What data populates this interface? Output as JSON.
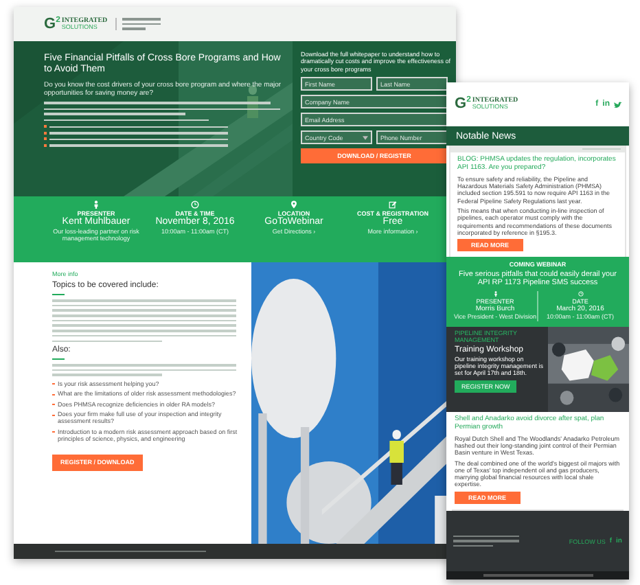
{
  "landing": {
    "logo": {
      "mark": "G$^{2}$",
      "name": "INTEGRATED",
      "sub": "SOLUTIONS"
    },
    "hero": {
      "title": "Five Financial Pitfalls of Cross Bore Programs and How to Avoid Them",
      "subtitle": "Do you know the cost drivers of your cross bore program and where the major opportunities for saving money are?"
    },
    "form": {
      "intro": "Download the full whitepaper to understand how to dramatically cut costs and improve the effectiveness of your cross bore programs",
      "fields": [
        {
          "placeholder": "First Name",
          "kind": "text"
        },
        {
          "placeholder": "Last Name",
          "kind": "text"
        },
        {
          "placeholder": "Company Name",
          "kind": "text"
        },
        {
          "placeholder": "Email Address",
          "kind": "text"
        },
        {
          "placeholder": "Country Code",
          "kind": "select"
        },
        {
          "placeholder": "Phone Number",
          "kind": "text"
        }
      ],
      "button": "DOWNLOAD / REGISTER"
    },
    "info": [
      {
        "kind": "person",
        "label": "PRESENTER",
        "value": "Kent Muhlbauer",
        "detail": "Our loss-leading partner on risk management technology"
      },
      {
        "kind": "clock",
        "label": "DATE & TIME",
        "value": "November 8, 2016",
        "detail": "10:00am - 11:00am (CT)"
      },
      {
        "kind": "pin",
        "label": "LOCATION",
        "value": "GoToWebinar",
        "detail": "Get Directions ›"
      },
      {
        "kind": "edit",
        "label": "COST & REGISTRATION",
        "value": "Free",
        "detail": "More information ›"
      }
    ],
    "content": {
      "eyebrow": "More info",
      "heading": "Topics to be covered include:",
      "heading2": "Also:",
      "bullets": [
        "Is your risk assessment helping you?",
        "What are the limitations of older risk assessment methodologies?",
        "Does PHMSA recognize deficiencies in older RA models?",
        "Does your firm make full use of your inspection and integrity assessment results?",
        "Introduction to a modern risk assessment approach based on first principles of science, physics, and engineering"
      ],
      "button": "REGISTER / DOWNLOAD"
    }
  },
  "email": {
    "logo": {
      "mark": "G$^{2}$",
      "name": "INTEGRATED",
      "sub": "SOLUTIONS"
    },
    "social": [
      "f",
      "in"
    ],
    "section": "Notable News",
    "article": {
      "title": "BLOG: PHMSA updates the regulation, incorporates API 1163. Are you prepared?",
      "paragraphs": [
        "To ensure safety and reliability, the Pipeline and Hazardous Materials Safety Administration (PHMSA) included section 195.591 to now require API 1163 in the Federal Pipeline Safety Regulations last year.",
        "This means that when conducting in-line inspection of pipelines, each operator must comply with the requirements and recommendations of these documents incorporated by reference in §195.3."
      ],
      "button": "READ MORE"
    },
    "webinar": {
      "eyebrow": "COMING WEBINAR",
      "title": "Five serious pitfalls that could easily derail your API RP 1173 Pipeline SMS success",
      "info": [
        {
          "kind": "person",
          "label": "PRESENTER",
          "value": "Morris Burch",
          "detail": "Vice President - West Division"
        },
        {
          "kind": "clock",
          "label": "DATE",
          "value": "March 20, 2016",
          "detail": "10:00am - 11:00am (CT)"
        }
      ]
    },
    "workshop": {
      "eyebrow": "PIPELINE INTEGRITY MANAGEMENT",
      "title": "Training Workshop",
      "text": "Our training workshop on pipeline integrity management is set for April 17th and 18th.",
      "button": "REGISTER NOW"
    },
    "article2": {
      "title": "Shell and Anadarko avoid divorce after spat, plan Permian growth",
      "paragraphs": [
        "Royal Dutch Shell and The Woodlands' Anadarko Petroleum hashed out their long-standing joint control of their Permian Basin venture in West Texas.",
        "The deal combined one of the world's biggest oil majors with one of Texas' top independent oil and gas producers, marrying global financial resources with local shale expertise."
      ],
      "button": "READ MORE"
    },
    "footer": {
      "connect": "FOLLOW US",
      "social": [
        "f",
        "in"
      ]
    }
  }
}
